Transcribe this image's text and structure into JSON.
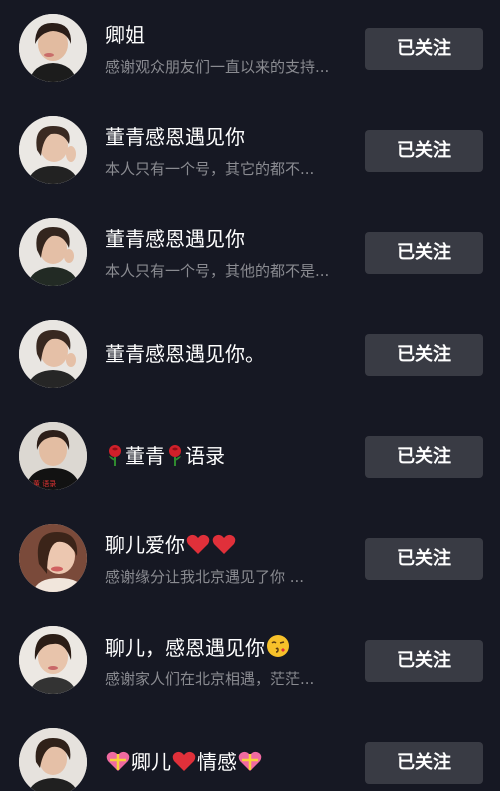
{
  "rows": [
    {
      "name": "卿姐",
      "desc": "感谢观众朋友们一直以来的支持...",
      "button": "已关注"
    },
    {
      "name": "董青感恩遇见你",
      "desc": "本人只有一个号，其它的都不...",
      "button": "已关注"
    },
    {
      "name": "董青感恩遇见你",
      "desc": "本人只有一个号，其他的都不是...",
      "button": "已关注"
    },
    {
      "name": "董青感恩遇见你。",
      "desc": "",
      "button": "已关注"
    },
    {
      "name_pre": "",
      "name_mid": "董青",
      "name_post": "语录",
      "desc": "",
      "button": "已关注",
      "icons": [
        "rose-icon",
        "rose-icon"
      ]
    },
    {
      "name": "聊儿爱你",
      "desc": "感谢缘分让我北京遇见了你 ...",
      "button": "已关注",
      "icons": [
        "heart-icon",
        "heart-icon"
      ]
    },
    {
      "name": "聊儿，感恩遇见你",
      "desc": "感谢家人们在北京相遇，茫茫...",
      "button": "已关注",
      "icons": [
        "kiss-face-icon"
      ]
    },
    {
      "name_a": "卿儿",
      "name_b": "情感",
      "desc": "",
      "button": "已关注",
      "icons": [
        "gift-heart-icon",
        "heart-icon",
        "gift-heart-icon"
      ]
    }
  ],
  "colors": {
    "background": "#161823",
    "button_bg": "#393b44",
    "name": "#ffffff",
    "desc": "#8a8b91",
    "heart": "#e0303a"
  }
}
